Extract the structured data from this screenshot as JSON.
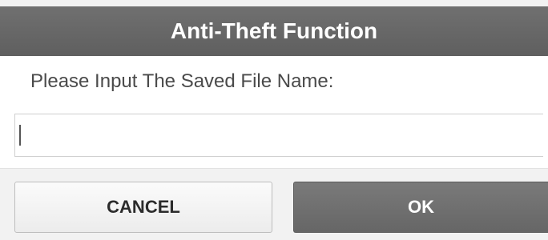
{
  "dialog": {
    "title": "Anti-Theft Function",
    "prompt": "Please Input The Saved File Name:",
    "input": {
      "value": "",
      "placeholder": ""
    },
    "buttons": {
      "cancel_label": "CANCEL",
      "ok_label": "OK"
    }
  },
  "colors": {
    "title_bar": "#666666",
    "ok_button": "#707070",
    "cancel_button": "#f4f4f4"
  }
}
